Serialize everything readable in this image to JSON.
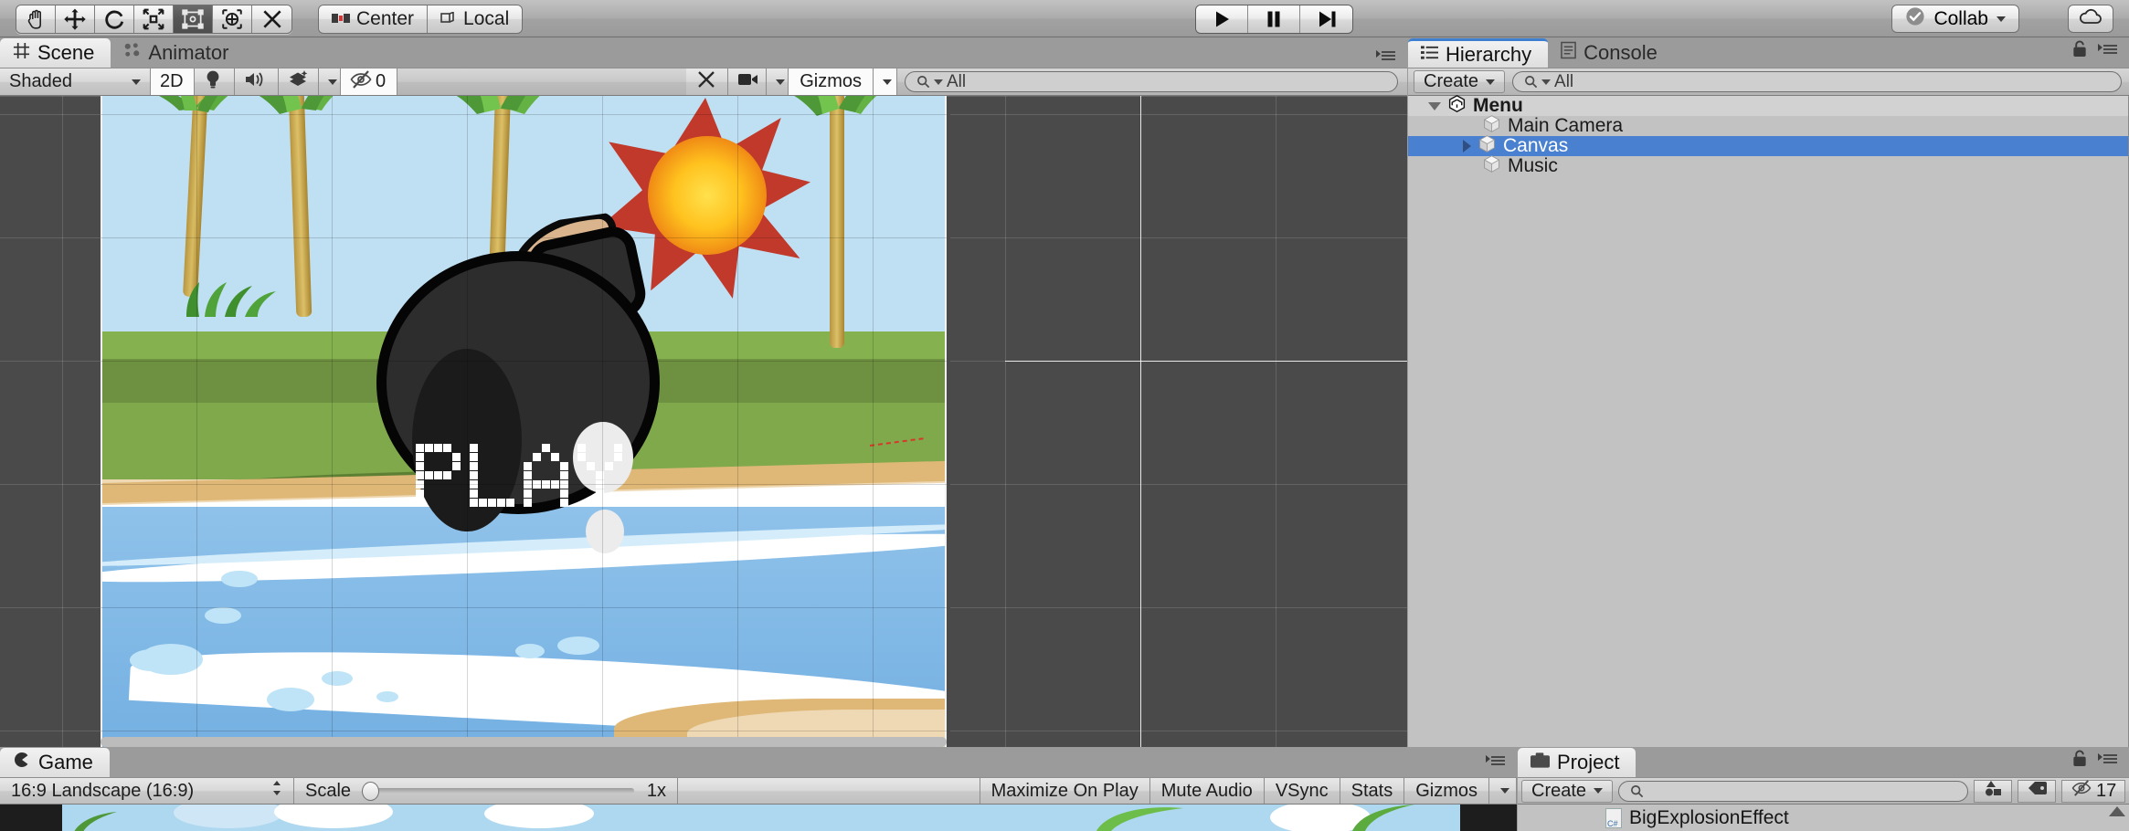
{
  "toolbar": {
    "tools": [
      {
        "name": "hand-tool",
        "icon": "hand"
      },
      {
        "name": "move-tool",
        "icon": "move"
      },
      {
        "name": "rotate-tool",
        "icon": "rotate"
      },
      {
        "name": "scale-tool",
        "icon": "scale"
      },
      {
        "name": "rect-tool",
        "icon": "rect",
        "selected": true
      },
      {
        "name": "transform-tool",
        "icon": "transform"
      },
      {
        "name": "custom-tool",
        "icon": "wrench"
      }
    ],
    "pivot_label": "Center",
    "space_label": "Local",
    "play_label": "Play",
    "pause_label": "Pause",
    "step_label": "Step",
    "collab_label": "Collab",
    "cloud_label": "Services"
  },
  "scene_panel": {
    "tabs": [
      {
        "label": "Scene",
        "icon": "grid-icon",
        "active": true
      },
      {
        "label": "Animator",
        "icon": "animator-icon",
        "active": false
      }
    ],
    "draw_mode": "Shaded",
    "mode_2d": "2D",
    "lighting_icon": "lightbulb-icon",
    "audio_icon": "speaker-icon",
    "effects_icon": "effects-icon",
    "hidden_count": "0",
    "tools_icon": "tools-icon",
    "camera_icon": "camera-icon",
    "gizmos_label": "Gizmos",
    "search_placeholder": "All"
  },
  "hierarchy": {
    "tabs": [
      {
        "label": "Hierarchy",
        "icon": "hierarchy-icon",
        "active": true
      },
      {
        "label": "Console",
        "icon": "console-icon",
        "active": false
      }
    ],
    "create_label": "Create",
    "search_placeholder": "All",
    "items": [
      {
        "label": "Menu",
        "depth": 0,
        "icon": "unity-scene-icon",
        "expanded": true,
        "selected": false
      },
      {
        "label": "Main Camera",
        "depth": 1,
        "icon": "gameobject-icon",
        "expanded": null,
        "selected": false
      },
      {
        "label": "Canvas",
        "depth": 1,
        "icon": "gameobject-icon",
        "expanded": false,
        "selected": true
      },
      {
        "label": "Music",
        "depth": 1,
        "icon": "gameobject-icon",
        "expanded": null,
        "selected": false
      }
    ]
  },
  "game_panel": {
    "tab_label": "Game",
    "tab_icon": "game-icon",
    "aspect": "16:9 Landscape (16:9)",
    "scale_label": "Scale",
    "scale_value": "1x",
    "maximize_label": "Maximize On Play",
    "mute_label": "Mute Audio",
    "vsync_label": "VSync",
    "stats_label": "Stats",
    "gizmos_label": "Gizmos"
  },
  "project_panel": {
    "tab_label": "Project",
    "tab_icon": "project-icon",
    "create_label": "Create",
    "search_placeholder": "",
    "favorite_icon": "favorite-icon",
    "label_icon": "label-icon",
    "hidden_count": "17",
    "items": [
      {
        "label": "BigExplosionEffect",
        "icon": "csharp-icon"
      }
    ]
  },
  "scene_content": {
    "button_text": "PLAY",
    "colors": {
      "sky": "#bfe0f3",
      "grass_light": "#8bb254",
      "grass_mid": "#6d9140",
      "grass_dark": "#4e6d2a",
      "sand": "#efd9b4",
      "sand_dark": "#dfb878",
      "water": "#7fbae6",
      "foam": "#ffffff",
      "bomb": "#2d2d2d",
      "explosion_red": "#c0392b",
      "explosion_yellow": "#ffc21e",
      "selection_blue": "#4a80d0"
    }
  }
}
